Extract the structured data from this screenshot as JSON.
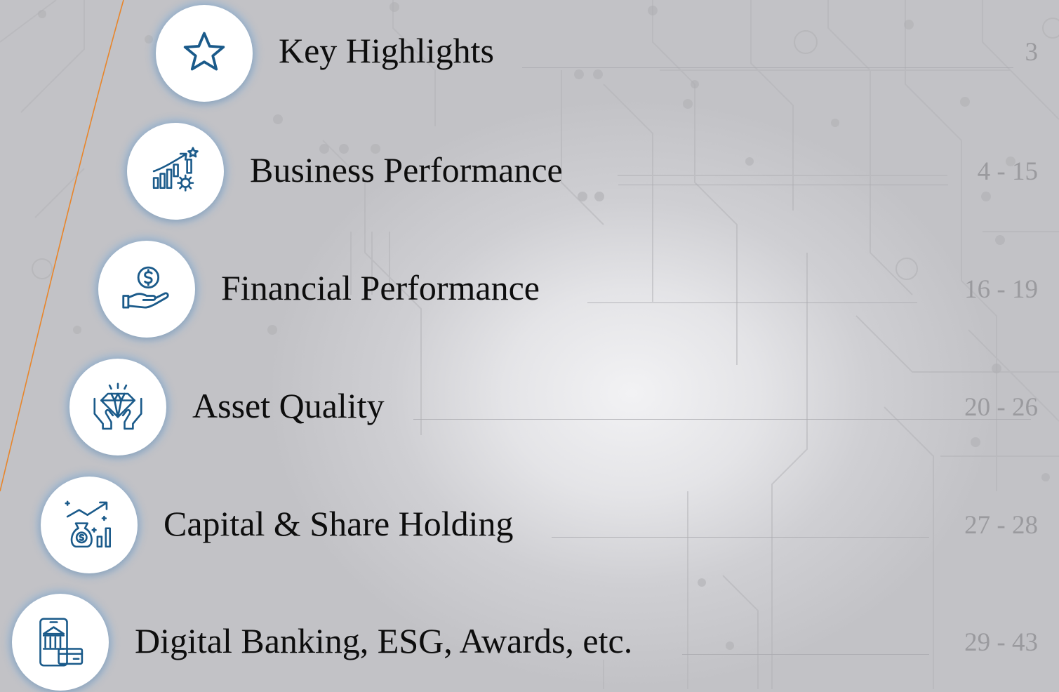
{
  "toc": {
    "items": [
      {
        "icon": "star-icon",
        "title": "Key Highlights",
        "pages": "3"
      },
      {
        "icon": "growth-chart-gear-icon",
        "title": "Business Performance",
        "pages": "4 - 15"
      },
      {
        "icon": "hand-dollar-coin-icon",
        "title": "Financial Performance",
        "pages": "16 - 19"
      },
      {
        "icon": "hands-diamond-icon",
        "title": "Asset Quality",
        "pages": "20 - 26"
      },
      {
        "icon": "money-bag-growth-icon",
        "title": "Capital & Share Holding",
        "pages": "27 - 28"
      },
      {
        "icon": "mobile-bank-card-icon",
        "title": "Digital Banking, ESG, Awards, etc.",
        "pages": "29 - 43"
      }
    ]
  },
  "colors": {
    "icon_stroke": "#1a5a8a",
    "accent_line": "#e8852a",
    "icon_glow": "#78aadc"
  }
}
